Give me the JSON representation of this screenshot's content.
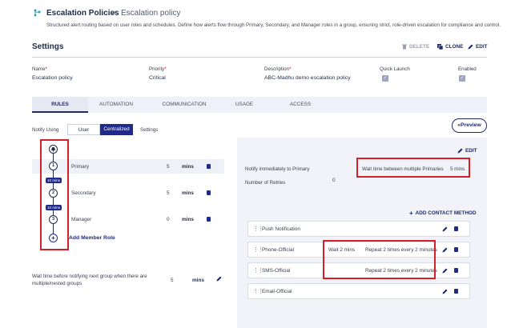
{
  "header": {
    "app_icon": "escalation-branch-icon",
    "title": "Escalation Policies",
    "separator": ">",
    "breadcrumb_current": "Escalation policy",
    "description": "Structured alert routing based on user roles and schedules. Define how alerts flow through Primary, Secondary, and Manager roles in a group, ensuring strict, role-driven escalation for compliance and control."
  },
  "settings": {
    "title": "Settings",
    "actions": {
      "delete": "DELETE",
      "clone": "CLONE",
      "edit": "EDIT"
    },
    "fields": {
      "name_label": "Name",
      "name_value": "Escalation policy",
      "priority_label": "Priority",
      "priority_value": "Critical",
      "description_label": "Description",
      "description_value": "ABC-Madhu demo escalation policy",
      "quick_launch_label": "Quick Launch",
      "enabled_label": "Enabled",
      "required_mark": "*",
      "check_glyph": "✓"
    }
  },
  "tabs": [
    "RULES",
    "AUTOMATION",
    "COMMUNICATION",
    "USAGE",
    "ACCESS"
  ],
  "notify": {
    "label": "Notify Using",
    "options": [
      "User",
      "Centralized",
      "Settings"
    ],
    "selected": "Centralized"
  },
  "preview_label": "Preview",
  "preview_icon": "«",
  "roles": [
    {
      "node": "1",
      "name": "Primary",
      "value": "5",
      "unit": "mins"
    },
    {
      "node": "2",
      "name": "Secondary",
      "value": "5",
      "unit": "mins"
    },
    {
      "node": "3",
      "name": "Manager",
      "value": "0",
      "unit": "mins"
    }
  ],
  "badges": [
    "10 mins",
    "10 mins"
  ],
  "add_node_glyph": "+",
  "add_member_label": "Add Member Role",
  "wait_time": {
    "label": "Wait time before notifying next group when there are multiple/nested groups",
    "value": "5",
    "unit": "mins"
  },
  "right_panel": {
    "edit_label": "EDIT",
    "notify_immediately": "Notify immediately to Primary",
    "wait_between_label": "Wait time between multiple Primaries",
    "wait_between_value": "5 mins",
    "retries_label": "Number of Retries",
    "retries_value": "0",
    "add_contact_label": "ADD CONTACT METHOD",
    "methods": [
      {
        "name": "Push Notification",
        "wait": "",
        "repeat": ""
      },
      {
        "name": "Phone-Official",
        "wait": "Wait 2 mins",
        "repeat": "Repeat 2 times every 2 minutes"
      },
      {
        "name": "SMS-Official",
        "wait": "",
        "repeat": "Repeat 2 times every 2 minutes"
      },
      {
        "name": "Email-Official",
        "wait": "",
        "repeat": ""
      }
    ]
  },
  "colors": {
    "accent": "#1f2a8a",
    "highlight_box": "#d3202a",
    "panel_bg": "#f1f3f8"
  }
}
